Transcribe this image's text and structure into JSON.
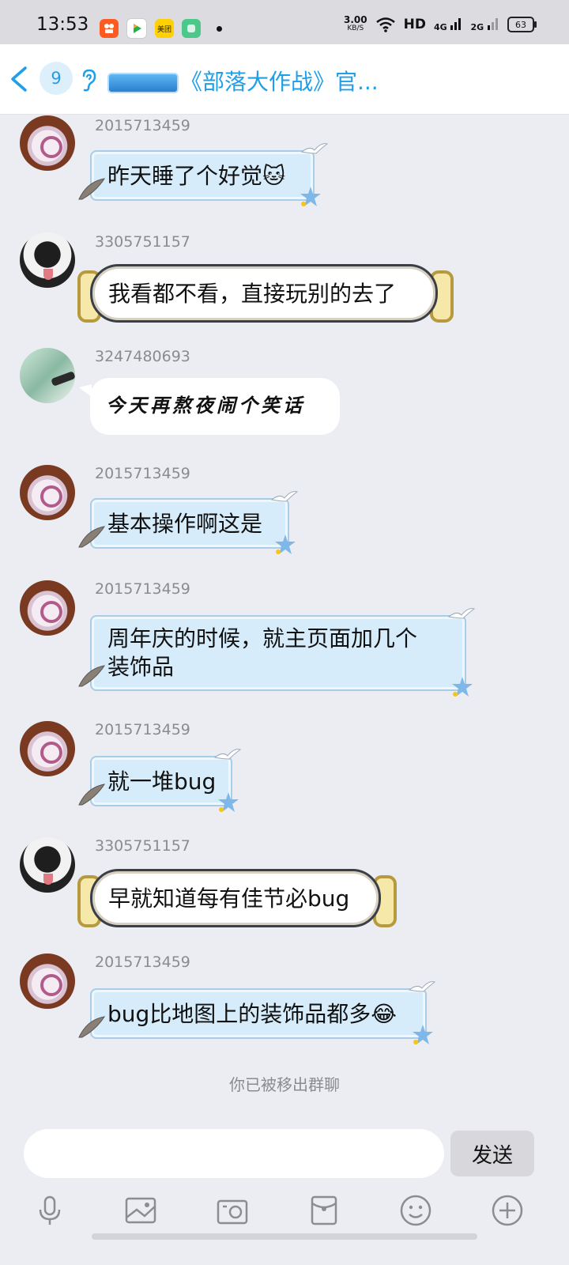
{
  "status_bar": {
    "time": "13:53",
    "net_speed_value": "3.00",
    "net_speed_unit": "KB/S",
    "hd_label": "HD",
    "signal_1": "4G",
    "signal_2": "2G",
    "battery": "63",
    "app_icons": [
      "kuaishou-icon",
      "video-player-icon",
      "meituan-icon",
      "app-icon",
      "notification-dot"
    ],
    "meituan_label": "美团"
  },
  "header": {
    "unread_count": "9",
    "title": "《部落大作战》官..."
  },
  "messages": [
    {
      "sender": "2015713459",
      "text": "昨天睡了个好觉🐱",
      "style": "blue-bubble",
      "avatar": "sheep-avatar"
    },
    {
      "sender": "3305751157",
      "text": "我看都不看，直接玩别的去了",
      "style": "white-scroll-bubble",
      "avatar": "panda-avatar"
    },
    {
      "sender": "3247480693",
      "text": "今天再熬夜闹个笑话",
      "style": "plain-bubble",
      "avatar": "mist-avatar"
    },
    {
      "sender": "2015713459",
      "text": "基本操作啊这是",
      "style": "blue-bubble",
      "avatar": "sheep-avatar"
    },
    {
      "sender": "2015713459",
      "text_line1": "周年庆的时候，就主页面加几个",
      "text_line2": "装饰品",
      "style": "blue-bubble",
      "avatar": "sheep-avatar"
    },
    {
      "sender": "2015713459",
      "text": "就一堆bug",
      "style": "blue-bubble",
      "avatar": "sheep-avatar"
    },
    {
      "sender": "3305751157",
      "text": "早就知道每有佳节必bug",
      "style": "white-scroll-bubble",
      "avatar": "panda-avatar"
    },
    {
      "sender": "2015713459",
      "text": "bug比地图上的装饰品都多😂",
      "style": "blue-bubble",
      "avatar": "sheep-avatar"
    }
  ],
  "system_note": "你已被移出群聊",
  "input": {
    "value": "",
    "placeholder": ""
  },
  "send_label": "发送",
  "toolbar_icons": [
    "microphone-icon",
    "image-icon",
    "camera-icon",
    "red-packet-icon",
    "emoji-icon",
    "plus-icon"
  ],
  "colors": {
    "accent": "#1e9fe8",
    "bubble_blue": "#d6ecfb",
    "background": "#ecedf2"
  }
}
